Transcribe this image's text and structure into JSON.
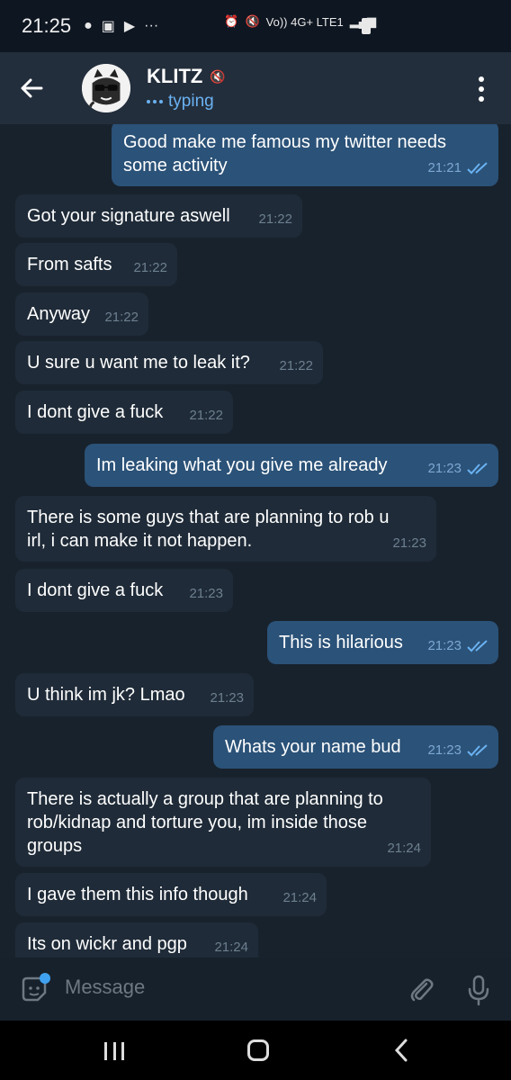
{
  "status_bar": {
    "time": "21:25",
    "network_label": "Vo)) 4G+ LTE1"
  },
  "header": {
    "title": "KLITZ",
    "status": "typing"
  },
  "messages": [
    {
      "dir": "out",
      "text": "Good make me famous my twitter needs\nsome activity",
      "time": "21:21"
    },
    {
      "dir": "in",
      "text": "Got your signature aswell",
      "time": "21:22"
    },
    {
      "dir": "in",
      "text": "From safts",
      "time": "21:22"
    },
    {
      "dir": "in",
      "text": "Anyway",
      "time": "21:22"
    },
    {
      "dir": "in",
      "text": "U sure u want me to leak it?",
      "time": "21:22"
    },
    {
      "dir": "in",
      "text": "I dont give a fuck",
      "time": "21:22"
    },
    {
      "dir": "out",
      "text": "Im leaking what you give me already",
      "time": "21:23"
    },
    {
      "dir": "in",
      "text": "There is some guys that are planning to rob u\nirl, i can make it not happen.",
      "time": "21:23"
    },
    {
      "dir": "in",
      "text": "I dont give a fuck",
      "time": "21:23"
    },
    {
      "dir": "out",
      "text": "This is hilarious",
      "time": "21:23"
    },
    {
      "dir": "in",
      "text": "U think im jk? Lmao",
      "time": "21:23"
    },
    {
      "dir": "out",
      "text": "Whats your name bud",
      "time": "21:23"
    },
    {
      "dir": "in",
      "text": "There is actually a group that are planning to\nrob/kidnap and torture you, im inside those\ngroups",
      "time": "21:24"
    },
    {
      "dir": "in",
      "text": "I gave them this info though",
      "time": "21:24"
    },
    {
      "dir": "in",
      "text": "Its on wickr and pgp",
      "time": "21:24"
    }
  ],
  "composer": {
    "placeholder": "Message"
  },
  "colors": {
    "background": "#18222d",
    "header": "#232e3c",
    "incoming_bubble": "#1f2b38",
    "outgoing_bubble": "#2b5278",
    "accent": "#6ab2f2"
  }
}
